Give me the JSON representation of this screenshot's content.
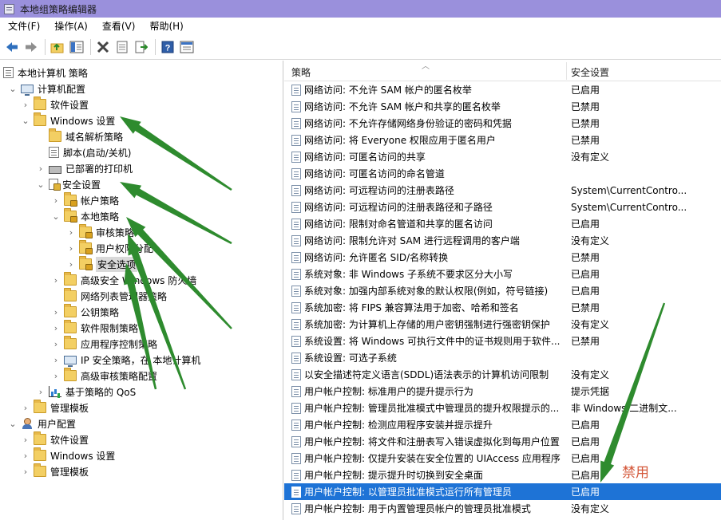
{
  "window": {
    "title": "本地组策略编辑器"
  },
  "menu": [
    "文件(F)",
    "操作(A)",
    "查看(V)",
    "帮助(H)"
  ],
  "toolbar": {
    "buttons": [
      "back-icon",
      "forward-icon",
      "up-folder-icon",
      "show-hide-tree-icon",
      "delete-icon",
      "properties-icon",
      "export-icon",
      "help-icon",
      "view-pane-icon"
    ]
  },
  "tree": [
    {
      "label": "本地计算机 策略",
      "icon": "policy-doc-icon",
      "depth": 0,
      "expander": ""
    },
    {
      "label": "计算机配置",
      "icon": "computer-icon",
      "depth": 1,
      "expander": "expanded"
    },
    {
      "label": "软件设置",
      "icon": "folder-icon",
      "depth": 2,
      "expander": "collapsed"
    },
    {
      "label": "Windows 设置",
      "icon": "folder-icon",
      "depth": 2,
      "expander": "expanded"
    },
    {
      "label": "域名解析策略",
      "icon": "folder-icon",
      "depth": 3,
      "expander": ""
    },
    {
      "label": "脚本(启动/关机)",
      "icon": "script-doc-icon",
      "depth": 3,
      "expander": ""
    },
    {
      "label": "已部署的打印机",
      "icon": "printer-icon",
      "depth": 3,
      "expander": "collapsed"
    },
    {
      "label": "安全设置",
      "icon": "security-settings-icon",
      "depth": 3,
      "expander": "expanded"
    },
    {
      "label": "帐户策略",
      "icon": "lock-folder-icon",
      "depth": 4,
      "expander": "collapsed"
    },
    {
      "label": "本地策略",
      "icon": "lock-folder-icon",
      "depth": 4,
      "expander": "expanded"
    },
    {
      "label": "审核策略",
      "icon": "lock-folder-icon",
      "depth": 5,
      "expander": "collapsed"
    },
    {
      "label": "用户权限分配",
      "icon": "lock-folder-icon",
      "depth": 5,
      "expander": "collapsed"
    },
    {
      "label": "安全选项",
      "icon": "lock-folder-icon",
      "depth": 5,
      "expander": "collapsed",
      "selected": true
    },
    {
      "label": "高级安全 Windows 防火墙",
      "icon": "folder-icon",
      "depth": 4,
      "expander": "collapsed"
    },
    {
      "label": "网络列表管理器策略",
      "icon": "folder-icon",
      "depth": 4,
      "expander": ""
    },
    {
      "label": "公钥策略",
      "icon": "folder-icon",
      "depth": 4,
      "expander": "collapsed"
    },
    {
      "label": "软件限制策略",
      "icon": "folder-icon",
      "depth": 4,
      "expander": "collapsed"
    },
    {
      "label": "应用程序控制策略",
      "icon": "folder-icon",
      "depth": 4,
      "expander": "collapsed"
    },
    {
      "label": "IP 安全策略，在 本地计算机",
      "icon": "ip-security-icon",
      "depth": 4,
      "expander": "collapsed"
    },
    {
      "label": "高级审核策略配置",
      "icon": "folder-icon",
      "depth": 4,
      "expander": "collapsed"
    },
    {
      "label": "基于策略的 QoS",
      "icon": "qos-chart-icon",
      "depth": 3,
      "expander": "collapsed"
    },
    {
      "label": "管理模板",
      "icon": "folder-icon",
      "depth": 2,
      "expander": "collapsed"
    },
    {
      "label": "用户配置",
      "icon": "user-icon",
      "depth": 1,
      "expander": "expanded"
    },
    {
      "label": "软件设置",
      "icon": "folder-icon",
      "depth": 2,
      "expander": "collapsed"
    },
    {
      "label": "Windows 设置",
      "icon": "folder-icon",
      "depth": 2,
      "expander": "collapsed"
    },
    {
      "label": "管理模板",
      "icon": "folder-icon",
      "depth": 2,
      "expander": "collapsed"
    }
  ],
  "list": {
    "columns": {
      "policy": "策略",
      "setting": "安全设置"
    },
    "rows": [
      {
        "name": "网络访问: 不允许 SAM 帐户的匿名枚举",
        "value": "已启用"
      },
      {
        "name": "网络访问: 不允许 SAM 帐户和共享的匿名枚举",
        "value": "已禁用"
      },
      {
        "name": "网络访问: 不允许存储网络身份验证的密码和凭据",
        "value": "已禁用"
      },
      {
        "name": "网络访问: 将 Everyone 权限应用于匿名用户",
        "value": "已禁用"
      },
      {
        "name": "网络访问: 可匿名访问的共享",
        "value": "没有定义"
      },
      {
        "name": "网络访问: 可匿名访问的命名管道",
        "value": ""
      },
      {
        "name": "网络访问: 可远程访问的注册表路径",
        "value": "System\\CurrentContro..."
      },
      {
        "name": "网络访问: 可远程访问的注册表路径和子路径",
        "value": "System\\CurrentContro..."
      },
      {
        "name": "网络访问: 限制对命名管道和共享的匿名访问",
        "value": "已启用"
      },
      {
        "name": "网络访问: 限制允许对 SAM 进行远程调用的客户端",
        "value": "没有定义"
      },
      {
        "name": "网络访问: 允许匿名 SID/名称转换",
        "value": "已禁用"
      },
      {
        "name": "系统对象: 非 Windows 子系统不要求区分大小写",
        "value": "已启用"
      },
      {
        "name": "系统对象: 加强内部系统对象的默认权限(例如，符号链接)",
        "value": "已启用"
      },
      {
        "name": "系统加密: 将 FIPS 兼容算法用于加密、哈希和签名",
        "value": "已禁用"
      },
      {
        "name": "系统加密: 为计算机上存储的用户密钥强制进行强密钥保护",
        "value": "没有定义"
      },
      {
        "name": "系统设置: 将 Windows 可执行文件中的证书规则用于软件...",
        "value": "已禁用"
      },
      {
        "name": "系统设置: 可选子系统",
        "value": ""
      },
      {
        "name": "以安全描述符定义语言(SDDL)语法表示的计算机访问限制",
        "value": "没有定义"
      },
      {
        "name": "用户帐户控制: 标准用户的提升提示行为",
        "value": "提示凭据"
      },
      {
        "name": "用户帐户控制: 管理员批准模式中管理员的提升权限提示的...",
        "value": "非 Windows 二进制文..."
      },
      {
        "name": "用户帐户控制: 检测应用程序安装并提示提升",
        "value": "已启用"
      },
      {
        "name": "用户帐户控制: 将文件和注册表写入错误虚拟化到每用户位置",
        "value": "已启用"
      },
      {
        "name": "用户帐户控制: 仅提升安装在安全位置的 UIAccess 应用程序",
        "value": "已启用"
      },
      {
        "name": "用户帐户控制: 提示提升时切换到安全桌面",
        "value": "已启用"
      },
      {
        "name": "用户帐户控制: 以管理员批准模式运行所有管理员",
        "value": "已启用",
        "selected": true
      },
      {
        "name": "用户帐户控制: 用于内置管理员帐户的管理员批准模式",
        "value": "没有定义"
      }
    ]
  },
  "annotation": {
    "text": "禁用",
    "arrow_color": "#2e8b2e"
  },
  "colors": {
    "titlebar": "#9a90dc",
    "selection": "#1e73d6",
    "arrow_green": "#2e8b2e",
    "annotation_red": "#d4583a"
  }
}
